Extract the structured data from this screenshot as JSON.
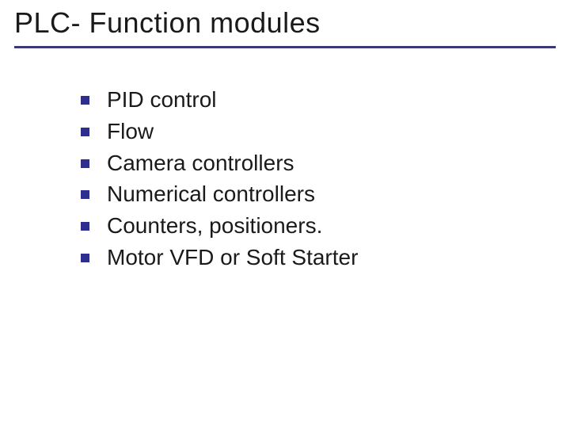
{
  "title": "PLC- Function modules",
  "bullets": [
    "PID control",
    "Flow",
    "Camera controllers",
    "Numerical controllers",
    "Counters, positioners.",
    "Motor VFD or Soft Starter"
  ]
}
